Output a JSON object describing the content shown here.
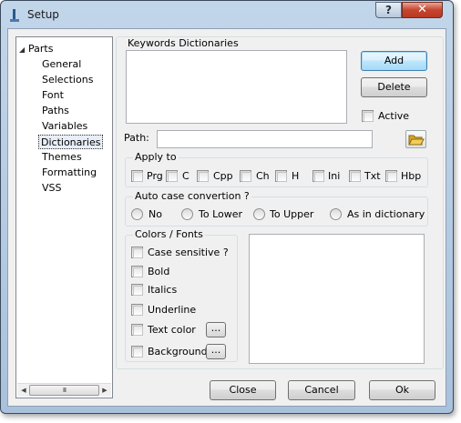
{
  "window": {
    "title": "Setup",
    "help_label": "?",
    "close_label": "✕"
  },
  "tree": {
    "root": "Parts",
    "items": [
      "General",
      "Selections",
      "Font",
      "Paths",
      "Variables",
      "Dictionaries",
      "Themes",
      "Formatting",
      "VSS"
    ],
    "selected": "Dictionaries",
    "scroll_thumb": "III"
  },
  "dictionaries": {
    "group_label": "Keywords Dictionaries",
    "add_label": "Add",
    "delete_label": "Delete",
    "active_label": "Active",
    "path_label": "Path:",
    "path_value": ""
  },
  "apply_to": {
    "label": "Apply to",
    "options": [
      "Prg",
      "C",
      "Cpp",
      "Ch",
      "H",
      "Ini",
      "Txt",
      "Hbp"
    ]
  },
  "auto_case": {
    "label": "Auto case convertion ?",
    "options": [
      "No",
      "To Lower",
      "To Upper",
      "As in dictionary"
    ]
  },
  "colors_fonts": {
    "label": "Colors / Fonts",
    "options": [
      "Case sensitive ?",
      "Bold",
      "Italics",
      "Underline",
      "Text color",
      "Background"
    ],
    "dots_label": "..."
  },
  "footer": {
    "close_label": "Close",
    "cancel_label": "Cancel",
    "ok_label": "Ok"
  }
}
